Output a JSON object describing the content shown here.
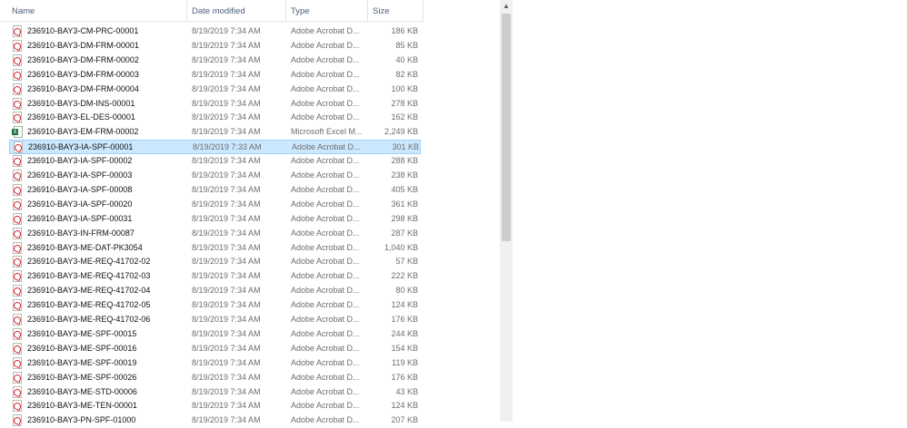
{
  "columns": {
    "name": "Name",
    "date": "Date modified",
    "type": "Type",
    "size": "Size"
  },
  "scrollbar": {
    "up_arrow": "▲"
  },
  "excel_tag": "X",
  "files": [
    {
      "name": "236910-BAY3-CM-PRC-00001",
      "date": "8/19/2019 7:34 AM",
      "type": "Adobe Acrobat D...",
      "size": "186 KB",
      "icon": "pdf-file-icon"
    },
    {
      "name": "236910-BAY3-DM-FRM-00001",
      "date": "8/19/2019 7:34 AM",
      "type": "Adobe Acrobat D...",
      "size": "85 KB",
      "icon": "pdf-file-icon"
    },
    {
      "name": "236910-BAY3-DM-FRM-00002",
      "date": "8/19/2019 7:34 AM",
      "type": "Adobe Acrobat D...",
      "size": "40 KB",
      "icon": "pdf-file-icon"
    },
    {
      "name": "236910-BAY3-DM-FRM-00003",
      "date": "8/19/2019 7:34 AM",
      "type": "Adobe Acrobat D...",
      "size": "82 KB",
      "icon": "pdf-file-icon"
    },
    {
      "name": "236910-BAY3-DM-FRM-00004",
      "date": "8/19/2019 7:34 AM",
      "type": "Adobe Acrobat D...",
      "size": "100 KB",
      "icon": "pdf-file-icon"
    },
    {
      "name": "236910-BAY3-DM-INS-00001",
      "date": "8/19/2019 7:34 AM",
      "type": "Adobe Acrobat D...",
      "size": "278 KB",
      "icon": "pdf-file-icon"
    },
    {
      "name": "236910-BAY3-EL-DES-00001",
      "date": "8/19/2019 7:34 AM",
      "type": "Adobe Acrobat D...",
      "size": "162 KB",
      "icon": "pdf-file-icon"
    },
    {
      "name": "236910-BAY3-EM-FRM-00002",
      "date": "8/19/2019 7:34 AM",
      "type": "Microsoft Excel M...",
      "size": "2,249 KB",
      "icon": "excel-file-icon"
    },
    {
      "name": "236910-BAY3-IA-SPF-00001",
      "date": "8/19/2019 7:33 AM",
      "type": "Adobe Acrobat D...",
      "size": "301 KB",
      "icon": "pdf-file-icon",
      "selected": true
    },
    {
      "name": "236910-BAY3-IA-SPF-00002",
      "date": "8/19/2019 7:34 AM",
      "type": "Adobe Acrobat D...",
      "size": "288 KB",
      "icon": "pdf-file-icon"
    },
    {
      "name": "236910-BAY3-IA-SPF-00003",
      "date": "8/19/2019 7:34 AM",
      "type": "Adobe Acrobat D...",
      "size": "238 KB",
      "icon": "pdf-file-icon"
    },
    {
      "name": "236910-BAY3-IA-SPF-00008",
      "date": "8/19/2019 7:34 AM",
      "type": "Adobe Acrobat D...",
      "size": "405 KB",
      "icon": "pdf-file-icon"
    },
    {
      "name": "236910-BAY3-IA-SPF-00020",
      "date": "8/19/2019 7:34 AM",
      "type": "Adobe Acrobat D...",
      "size": "361 KB",
      "icon": "pdf-file-icon"
    },
    {
      "name": "236910-BAY3-IA-SPF-00031",
      "date": "8/19/2019 7:34 AM",
      "type": "Adobe Acrobat D...",
      "size": "298 KB",
      "icon": "pdf-file-icon"
    },
    {
      "name": "236910-BAY3-IN-FRM-00087",
      "date": "8/19/2019 7:34 AM",
      "type": "Adobe Acrobat D...",
      "size": "287 KB",
      "icon": "pdf-file-icon"
    },
    {
      "name": "236910-BAY3-ME-DAT-PK3054",
      "date": "8/19/2019 7:34 AM",
      "type": "Adobe Acrobat D...",
      "size": "1,040 KB",
      "icon": "pdf-file-icon"
    },
    {
      "name": "236910-BAY3-ME-REQ-41702-02",
      "date": "8/19/2019 7:34 AM",
      "type": "Adobe Acrobat D...",
      "size": "57 KB",
      "icon": "pdf-file-icon"
    },
    {
      "name": "236910-BAY3-ME-REQ-41702-03",
      "date": "8/19/2019 7:34 AM",
      "type": "Adobe Acrobat D...",
      "size": "222 KB",
      "icon": "pdf-file-icon"
    },
    {
      "name": "236910-BAY3-ME-REQ-41702-04",
      "date": "8/19/2019 7:34 AM",
      "type": "Adobe Acrobat D...",
      "size": "80 KB",
      "icon": "pdf-file-icon"
    },
    {
      "name": "236910-BAY3-ME-REQ-41702-05",
      "date": "8/19/2019 7:34 AM",
      "type": "Adobe Acrobat D...",
      "size": "124 KB",
      "icon": "pdf-file-icon"
    },
    {
      "name": "236910-BAY3-ME-REQ-41702-06",
      "date": "8/19/2019 7:34 AM",
      "type": "Adobe Acrobat D...",
      "size": "176 KB",
      "icon": "pdf-file-icon"
    },
    {
      "name": "236910-BAY3-ME-SPF-00015",
      "date": "8/19/2019 7:34 AM",
      "type": "Adobe Acrobat D...",
      "size": "244 KB",
      "icon": "pdf-file-icon"
    },
    {
      "name": "236910-BAY3-ME-SPF-00016",
      "date": "8/19/2019 7:34 AM",
      "type": "Adobe Acrobat D...",
      "size": "154 KB",
      "icon": "pdf-file-icon"
    },
    {
      "name": "236910-BAY3-ME-SPF-00019",
      "date": "8/19/2019 7:34 AM",
      "type": "Adobe Acrobat D...",
      "size": "119 KB",
      "icon": "pdf-file-icon"
    },
    {
      "name": "236910-BAY3-ME-SPF-00026",
      "date": "8/19/2019 7:34 AM",
      "type": "Adobe Acrobat D...",
      "size": "176 KB",
      "icon": "pdf-file-icon"
    },
    {
      "name": "236910-BAY3-ME-STD-00006",
      "date": "8/19/2019 7:34 AM",
      "type": "Adobe Acrobat D...",
      "size": "43 KB",
      "icon": "pdf-file-icon"
    },
    {
      "name": "236910-BAY3-ME-TEN-00001",
      "date": "8/19/2019 7:34 AM",
      "type": "Adobe Acrobat D...",
      "size": "124 KB",
      "icon": "pdf-file-icon"
    },
    {
      "name": "236910-BAY3-PN-SPF-01000",
      "date": "8/19/2019 7:34 AM",
      "type": "Adobe Acrobat D...",
      "size": "207 KB",
      "icon": "pdf-file-icon"
    }
  ]
}
